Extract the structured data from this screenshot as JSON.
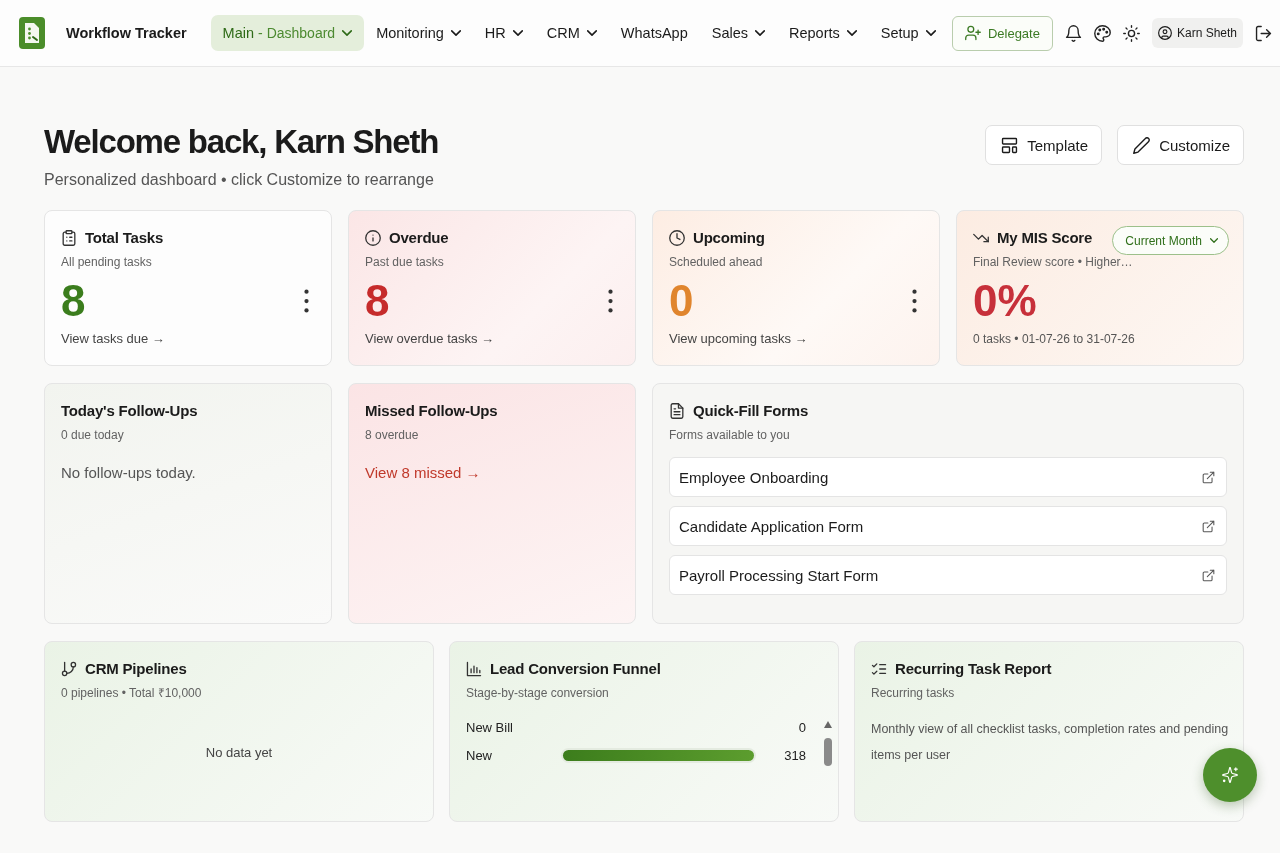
{
  "header": {
    "app_name": "Workflow Tracker",
    "nav": [
      {
        "label": "Main",
        "detail": "- Dashboard",
        "selected": true,
        "dropdown": true
      },
      {
        "label": "Monitoring",
        "selected": false,
        "dropdown": true
      },
      {
        "label": "HR",
        "selected": false,
        "dropdown": true
      },
      {
        "label": "CRM",
        "selected": false,
        "dropdown": true
      },
      {
        "label": "WhatsApp",
        "selected": false,
        "dropdown": false
      },
      {
        "label": "Sales",
        "selected": false,
        "dropdown": true
      },
      {
        "label": "Reports",
        "selected": false,
        "dropdown": true
      },
      {
        "label": "Setup",
        "selected": false,
        "dropdown": true
      }
    ],
    "delegate_button": "Delegate",
    "user": "Karn Sheth"
  },
  "welcome": {
    "title": "Welcome back, Karn Sheth",
    "subtitle": "Personalized dashboard • click Customize to rearrange",
    "template_button": "Template",
    "customize_button": "Customize"
  },
  "total_tasks": {
    "title": "Total Tasks",
    "subtitle": "All pending tasks",
    "value": "8",
    "link": "View tasks due →"
  },
  "overdue": {
    "title": "Overdue",
    "subtitle": "Past due tasks",
    "value": "8",
    "link": "View overdue tasks →"
  },
  "upcoming": {
    "title": "Upcoming",
    "subtitle": "Scheduled ahead",
    "value": "0",
    "link": "View upcoming tasks →"
  },
  "mis_score": {
    "title": "My MIS Score",
    "period": "Current Month",
    "subtitle": "Final Review score • Higher…",
    "value": "0%",
    "detail": "0 tasks • 01-07-26 to 31-07-26"
  },
  "todays_follow_ups": {
    "title": "Today's Follow-Ups",
    "subtitle": "0 due today",
    "message": "No follow-ups today."
  },
  "missed_follow_ups": {
    "title": "Missed Follow-Ups",
    "subtitle": "8 overdue",
    "link": "View 8 missed →"
  },
  "quick_fill_forms": {
    "title": "Quick-Fill Forms",
    "subtitle": "Forms available to you",
    "forms": [
      "Employee Onboarding",
      "Candidate Application Form",
      "Payroll Processing Start Form"
    ]
  },
  "crm_pipelines": {
    "title": "CRM Pipelines",
    "subtitle": "0 pipelines • Total ₹10,000",
    "empty_message": "No data yet"
  },
  "lead_conversion_funnel": {
    "title": "Lead Conversion Funnel",
    "subtitle": "Stage-by-stage conversion",
    "stages": [
      {
        "name": "New Bill",
        "count": "0"
      },
      {
        "name": "New",
        "count": "318",
        "level": 1
      }
    ]
  },
  "recurring_task_report": {
    "title": "Recurring Task Report",
    "subtitle": "Recurring tasks",
    "description": "Monthly view of all checklist tasks, completion rates and pending items per user"
  }
}
